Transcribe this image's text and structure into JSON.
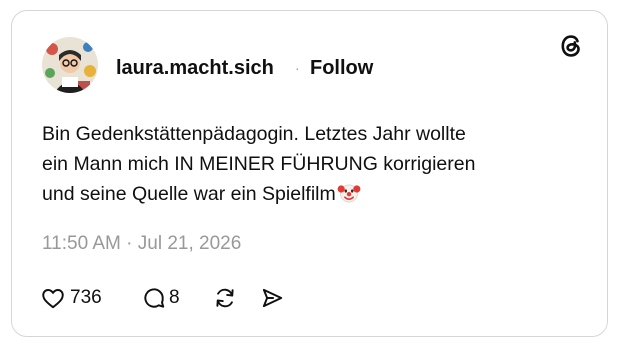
{
  "post": {
    "username": "laura.macht.sich",
    "separator": "·",
    "follow_label": "Follow",
    "text_lines": [
      "Bin Gedenkstättenpädagogin. Letztes Jahr wollte",
      "ein Mann mich IN MEINER FÜHRUNG korrigieren",
      "und seine Quelle war ein Spielfilm"
    ],
    "trailing_emoji": "clown-face-icon",
    "timestamp": "11:50 AM · Jul 21, 2026",
    "stats": {
      "likes": "736",
      "replies": "8"
    }
  },
  "icons": {
    "brand": "threads-logo-icon",
    "like": "heart-icon",
    "reply": "reply-bubble-icon",
    "repost": "repost-icon",
    "share": "send-icon"
  },
  "colors": {
    "text": "#101010",
    "muted": "#999999",
    "border": "#d6d6d6"
  }
}
